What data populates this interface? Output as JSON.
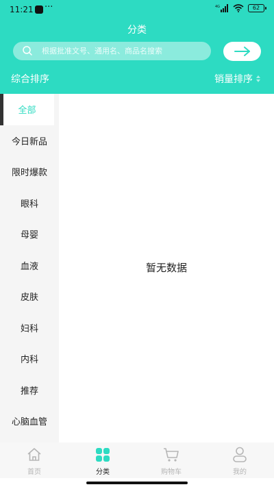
{
  "status_bar": {
    "time": "11:21",
    "dots": "···",
    "network": "4G",
    "battery": "62"
  },
  "header": {
    "title": "分类",
    "search": {
      "placeholder": "根据批准文号、通用名、商品名搜索",
      "value": ""
    },
    "sort_left": "综合排序",
    "sort_right": "销量排序"
  },
  "sidebar": {
    "active_index": 0,
    "items": [
      {
        "label": "全部"
      },
      {
        "label": "今日新品"
      },
      {
        "label": "限时爆款"
      },
      {
        "label": "眼科"
      },
      {
        "label": "母婴"
      },
      {
        "label": "血液"
      },
      {
        "label": "皮肤"
      },
      {
        "label": "妇科"
      },
      {
        "label": "内科"
      },
      {
        "label": "推荐"
      },
      {
        "label": "心脑血管"
      }
    ]
  },
  "main": {
    "empty_text": "暂无数据"
  },
  "tabbar": {
    "active_index": 1,
    "tabs": [
      {
        "label": "首页",
        "icon": "home-icon"
      },
      {
        "label": "分类",
        "icon": "category-icon"
      },
      {
        "label": "购物车",
        "icon": "cart-icon"
      },
      {
        "label": "我的",
        "icon": "profile-icon"
      }
    ]
  },
  "colors": {
    "accent": "#2ddbc2",
    "sidebar_bg": "#f5f5f5",
    "tab_inactive": "#b5b5b5"
  }
}
